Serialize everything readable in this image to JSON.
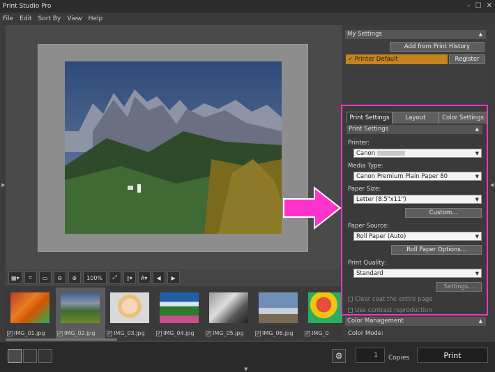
{
  "app": {
    "title": "Print Studio Pro",
    "minimize": "–",
    "maximize": "☐",
    "close": "✕"
  },
  "menu": [
    "File",
    "Edit",
    "Sort By",
    "View",
    "Help"
  ],
  "toolbar": {
    "zoom": "100%"
  },
  "filmstrip": [
    {
      "label": "IMG_01.jpg",
      "checked": true,
      "selected": false
    },
    {
      "label": "IMG_02.jpg",
      "checked": true,
      "selected": true
    },
    {
      "label": "IMG_03.jpg",
      "checked": true,
      "selected": false
    },
    {
      "label": "IMG_04.jpg",
      "checked": true,
      "selected": false
    },
    {
      "label": "IMG_05.jpg",
      "checked": true,
      "selected": false
    },
    {
      "label": "IMG_06.jpg",
      "checked": true,
      "selected": false
    },
    {
      "label": "IMG_0",
      "checked": true,
      "selected": false
    }
  ],
  "my_settings": {
    "title": "My Settings",
    "add_history": "Add from Print History",
    "printer_default": "Printer Default",
    "register": "Register"
  },
  "print_settings": {
    "tabs": [
      "Print Settings",
      "Layout",
      "Color Settings"
    ],
    "section_title": "Print Settings",
    "printer_label": "Printer:",
    "printer_value": "Canon",
    "media_label": "Media Type:",
    "media_value": "Canon Premium Plain Paper 80",
    "size_label": "Paper Size:",
    "size_value": "Letter (8.5\"x11\")",
    "custom_btn": "Custom...",
    "source_label": "Paper Source:",
    "source_value": "Roll Paper (Auto)",
    "roll_btn": "Roll Paper Options...",
    "quality_label": "Print Quality:",
    "quality_value": "Standard",
    "settings_btn": "Settings...",
    "clear_coat": "Clear coat the entire page",
    "contrast": "Use contrast reproduction"
  },
  "color_mgmt": {
    "title": "Color Management",
    "color_mode_label": "Color Mode:"
  },
  "bottom": {
    "copies_value": "1",
    "copies_label": "Copies",
    "print_label": "Print"
  },
  "colors": {
    "highlight": "#ff33cc",
    "printer_default_bg": "#c7841e",
    "arrow": "#ff33cc"
  }
}
